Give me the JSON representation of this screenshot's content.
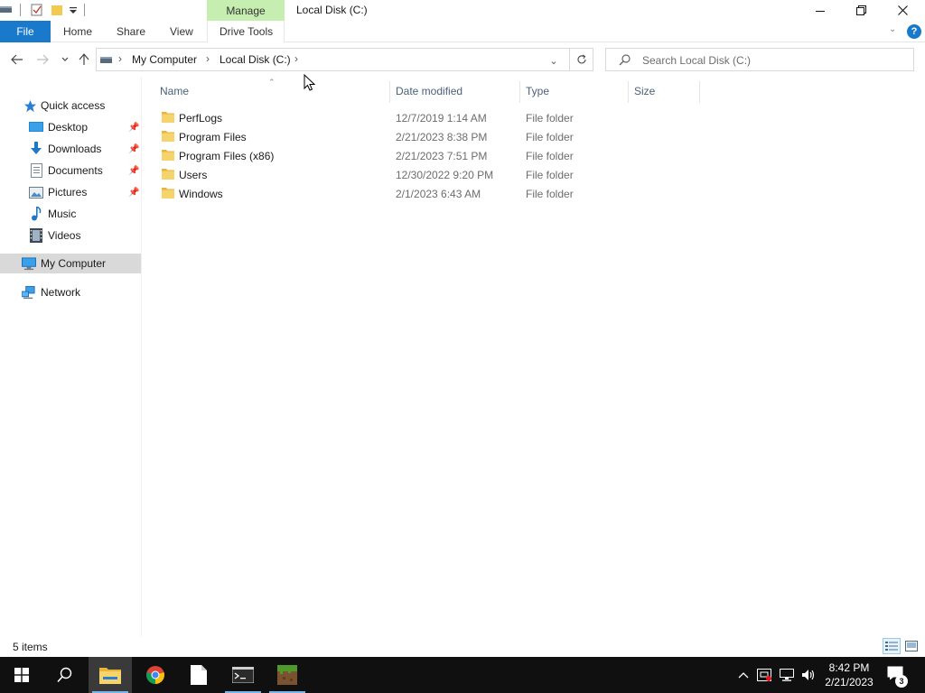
{
  "window": {
    "title": "Local Disk (C:)",
    "manage_tab": "Manage"
  },
  "ribbon": {
    "tabs": [
      "File",
      "Home",
      "Share",
      "View",
      "Drive Tools"
    ]
  },
  "address": {
    "crumbs": [
      "My Computer",
      "Local Disk (C:)"
    ],
    "search_placeholder": "Search Local Disk (C:)"
  },
  "navpane": {
    "items": [
      {
        "label": "Quick access",
        "icon": "star-icon",
        "pinned": false
      },
      {
        "label": "Desktop",
        "icon": "desktop-icon",
        "pinned": true
      },
      {
        "label": "Downloads",
        "icon": "download-icon",
        "pinned": true
      },
      {
        "label": "Documents",
        "icon": "document-icon",
        "pinned": true
      },
      {
        "label": "Pictures",
        "icon": "pictures-icon",
        "pinned": true
      },
      {
        "label": "Music",
        "icon": "music-icon",
        "pinned": false
      },
      {
        "label": "Videos",
        "icon": "video-icon",
        "pinned": false
      },
      {
        "label": "My Computer",
        "icon": "computer-icon",
        "pinned": false,
        "selected": true
      },
      {
        "label": "Network",
        "icon": "network-icon",
        "pinned": false
      }
    ]
  },
  "columns": [
    "Name",
    "Date modified",
    "Type",
    "Size"
  ],
  "files": [
    {
      "name": "PerfLogs",
      "date": "12/7/2019 1:14 AM",
      "type": "File folder"
    },
    {
      "name": "Program Files",
      "date": "2/21/2023 8:38 PM",
      "type": "File folder"
    },
    {
      "name": "Program Files (x86)",
      "date": "2/21/2023 7:51 PM",
      "type": "File folder"
    },
    {
      "name": "Users",
      "date": "12/30/2022 9:20 PM",
      "type": "File folder"
    },
    {
      "name": "Windows",
      "date": "2/1/2023 6:43 AM",
      "type": "File folder"
    }
  ],
  "status": {
    "item_count": "5 items"
  },
  "taskbar": {
    "time": "8:42 PM",
    "date": "2/21/2023",
    "notification_count": "3"
  },
  "colors": {
    "accent": "#1979ca",
    "manage_tab": "#c6eeb1",
    "selection": "#d9d9d9",
    "folder": "#f4c94f",
    "taskbar": "#101010"
  }
}
